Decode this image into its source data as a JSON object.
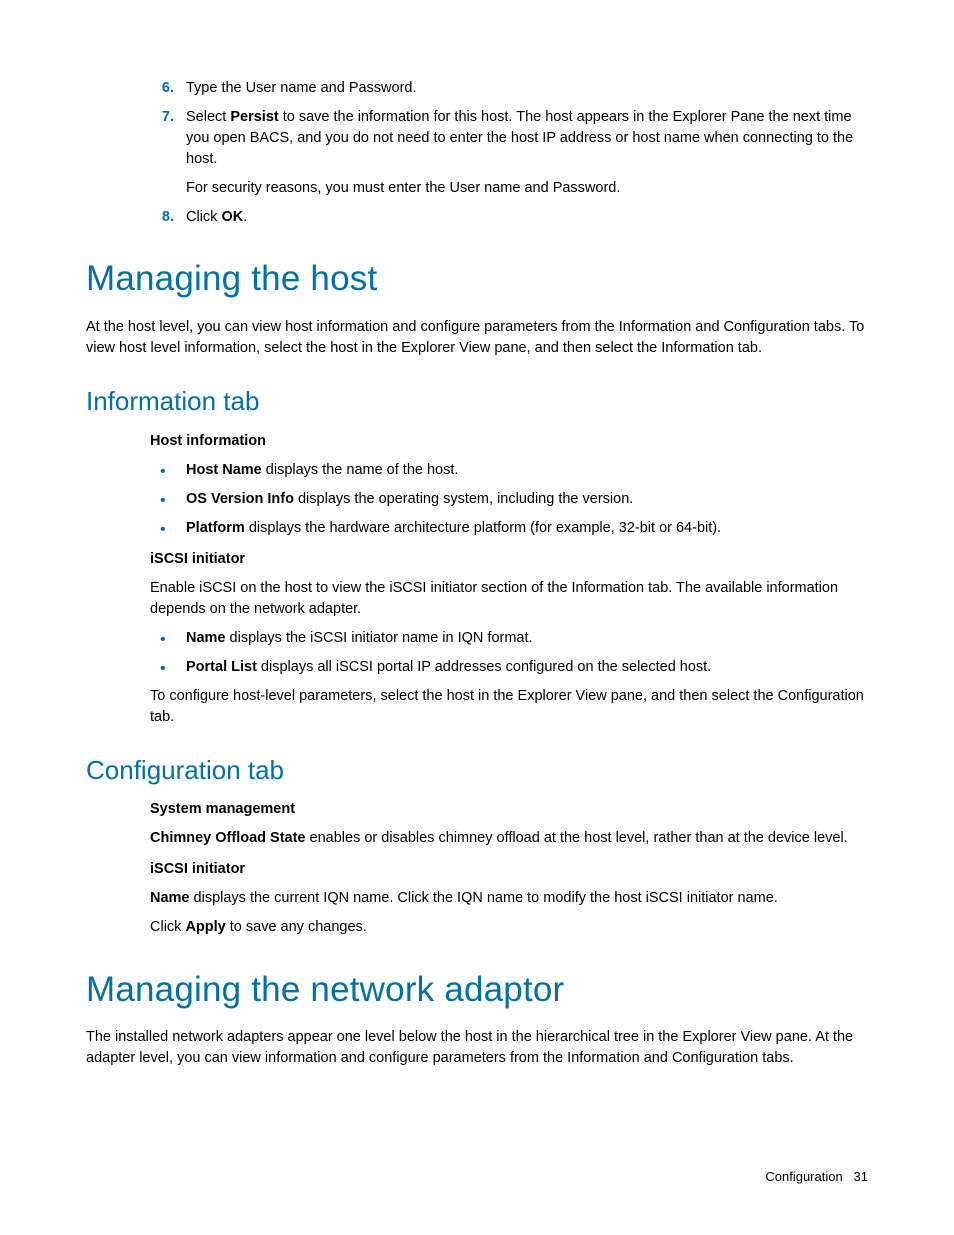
{
  "steps": {
    "s6": {
      "num": "6.",
      "text": "Type the User name and Password."
    },
    "s7": {
      "num": "7.",
      "prefix": "Select ",
      "bold": "Persist",
      "suffix": " to save the information for this host. The host appears in the Explorer Pane the next time you open BACS, and you do not need to enter the host IP address or host name when connecting to the host.",
      "extra": "For security reasons, you must enter the User name and Password."
    },
    "s8": {
      "num": "8.",
      "prefix": "Click ",
      "bold": "OK",
      "suffix": "."
    }
  },
  "h1_host": "Managing the host",
  "host_intro": "At the host level, you can view host information and configure parameters from the Information and Configuration tabs. To view host level information, select the host in the Explorer View pane, and then select the Information tab.",
  "h2_info": "Information tab",
  "info": {
    "subhead1": "Host information",
    "bullets1": {
      "b1": {
        "bold": "Host Name",
        "rest": " displays the name of the host."
      },
      "b2": {
        "bold": "OS Version Info",
        "rest": " displays the operating system, including the version."
      },
      "b3": {
        "bold": "Platform",
        "rest": " displays the hardware architecture platform (for example, 32-bit or 64-bit)."
      }
    },
    "subhead2": "iSCSI initiator",
    "para1": "Enable iSCSI on the host to view the iSCSI initiator section of the Information tab. The available information depends on the network adapter.",
    "bullets2": {
      "b1": {
        "bold": "Name",
        "rest": " displays the iSCSI initiator name in IQN format."
      },
      "b2": {
        "bold": "Portal List",
        "rest": " displays all iSCSI portal IP addresses configured on the selected host."
      }
    },
    "para2": "To configure host-level parameters, select the host in the Explorer View pane, and then select the Configuration tab."
  },
  "h2_config": "Configuration tab",
  "config": {
    "subhead1": "System management",
    "chimney": {
      "bold": "Chimney Offload State",
      "rest": " enables or disables chimney offload at the host level, rather than at the device level."
    },
    "subhead2": "iSCSI initiator",
    "name": {
      "bold": "Name",
      "rest": " displays the current IQN name. Click the IQN name to modify the host iSCSI initiator name."
    },
    "apply": {
      "prefix": "Click ",
      "bold": "Apply",
      "suffix": " to save any changes."
    }
  },
  "h1_adaptor": "Managing the network adaptor",
  "adaptor_intro": "The installed network adapters appear one level below the host in the hierarchical tree in the Explorer View pane. At the adapter level, you can view information and configure parameters from the Information and Configuration tabs.",
  "footer": {
    "section": "Configuration",
    "page": "31"
  }
}
